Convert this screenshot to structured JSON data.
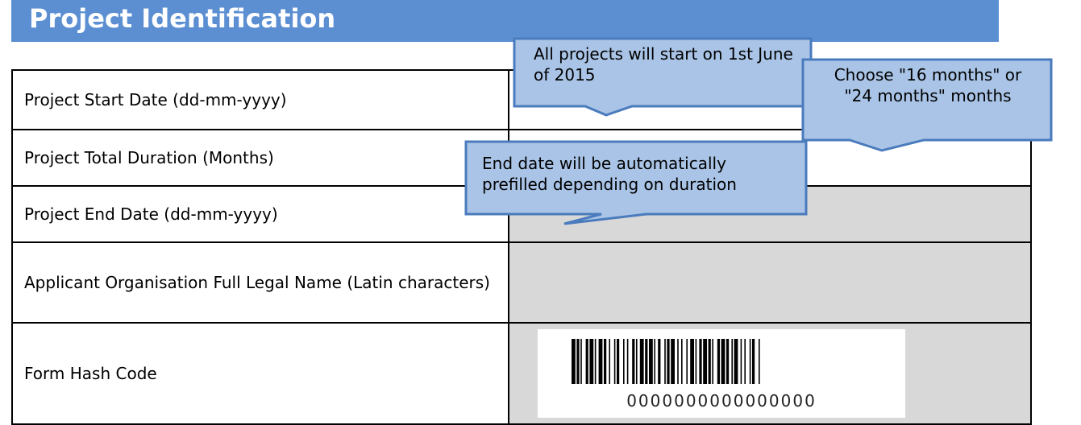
{
  "section": {
    "title": "Project Identification"
  },
  "rows": [
    {
      "label": "Project Start Date (dd-mm-yyyy)",
      "value": ""
    },
    {
      "label": "Project Total Duration (Months)",
      "value": ""
    },
    {
      "label": "Project End Date (dd-mm-yyyy)",
      "value": ""
    },
    {
      "label": "Applicant Organisation Full Legal Name (Latin characters)",
      "value": ""
    },
    {
      "label": "Form Hash Code",
      "value": "0000000000000000"
    }
  ],
  "callouts": {
    "start_date": "All projects will start on 1st June of 2015",
    "duration": "Choose \"16 months\" or \"24 months\" months",
    "end_date": "End date will be automatically prefilled depending on duration"
  },
  "colors": {
    "header": "#5b8fd2",
    "callout_fill": "#a9c4e6",
    "callout_border": "#4a7bbd",
    "readonly_fill": "#d8d8d8"
  }
}
